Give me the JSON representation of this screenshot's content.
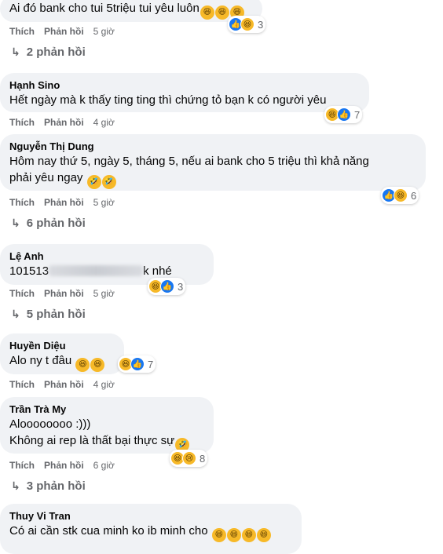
{
  "labels": {
    "like": "Thích",
    "reply": "Phản hồi"
  },
  "comments": [
    {
      "name": "",
      "text": "Ai đó bank cho tui 5triệu tui yêu luôn",
      "time": "5 giờ",
      "reaction_count": "3",
      "replies": "2 phản hồi"
    },
    {
      "name": "Hạnh Sino",
      "text": "Hết ngày mà k thấy ting ting thì chứng tỏ bạn k có người yêu",
      "time": "4 giờ",
      "reaction_count": "7",
      "replies": ""
    },
    {
      "name": "Nguyễn Thị Dung",
      "text_line1": "Hôm nay thứ 5, ngày 5, tháng 5, nếu ai bank cho 5 triệu thì khả năng",
      "text_line2": "phải yêu ngay",
      "time": "5 giờ",
      "reaction_count": "6",
      "replies": "6 phản hồi"
    },
    {
      "name": "Lệ Anh",
      "text_prefix": "101513",
      "text_suffix": "k nhé",
      "time": "5 giờ",
      "reaction_count": "3",
      "replies": "5 phản hồi"
    },
    {
      "name": "Huyền Diệu",
      "text": "Alo ny t đâu",
      "time": "4 giờ",
      "reaction_count": "7",
      "replies": ""
    },
    {
      "name": "Trần Trà My",
      "text_line1": "Aloooooooo :)))",
      "text_line2": "Không ai rep là thất bại thực sự",
      "time": "6 giờ",
      "reaction_count": "8",
      "replies": "3 phản hồi"
    },
    {
      "name": "Thuy Vi Tran",
      "text": "Có ai cần stk cua minh ko ib minh cho",
      "time": "",
      "reaction_count": "",
      "replies": ""
    }
  ],
  "icons": {
    "like": "thumbs-up-icon",
    "haha": "laughing-face-icon",
    "sad": "crying-face-icon",
    "reply_arrow": "reply-arrow-icon"
  },
  "colors": {
    "bubble": "#f0f2f5",
    "like_blue": "#1877f2",
    "emoji_yellow": "#f7b928",
    "meta_gray": "#65676b"
  }
}
